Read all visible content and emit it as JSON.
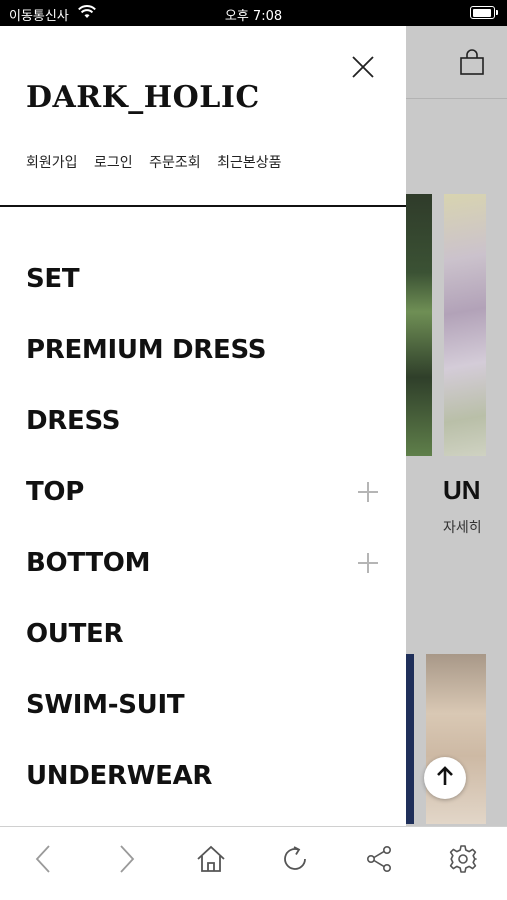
{
  "status_bar": {
    "carrier": "이동통신사",
    "time": "오후 7:08"
  },
  "drawer": {
    "logo": "DARK_HOLIC",
    "links": [
      "회원가입",
      "로그인",
      "주문조회",
      "최근본상품"
    ],
    "menu": [
      {
        "label": "SET",
        "expandable": false
      },
      {
        "label": "PREMIUM DRESS",
        "expandable": false
      },
      {
        "label": "DRESS",
        "expandable": false
      },
      {
        "label": "TOP",
        "expandable": true
      },
      {
        "label": "BOTTOM",
        "expandable": true
      },
      {
        "label": "OUTER",
        "expandable": false
      },
      {
        "label": "SWIM-SUIT",
        "expandable": false
      },
      {
        "label": "UNDERWEAR",
        "expandable": false
      }
    ]
  },
  "background": {
    "title": "UN",
    "subtitle": "자세히"
  },
  "toolbar": {
    "icons": [
      "back-icon",
      "forward-icon",
      "home-icon",
      "refresh-icon",
      "share-icon",
      "settings-icon"
    ]
  },
  "colors": {
    "text": "#111111",
    "overlay": "#c9c9c9",
    "icon": "#555555",
    "plus": "#b5b5b5"
  }
}
